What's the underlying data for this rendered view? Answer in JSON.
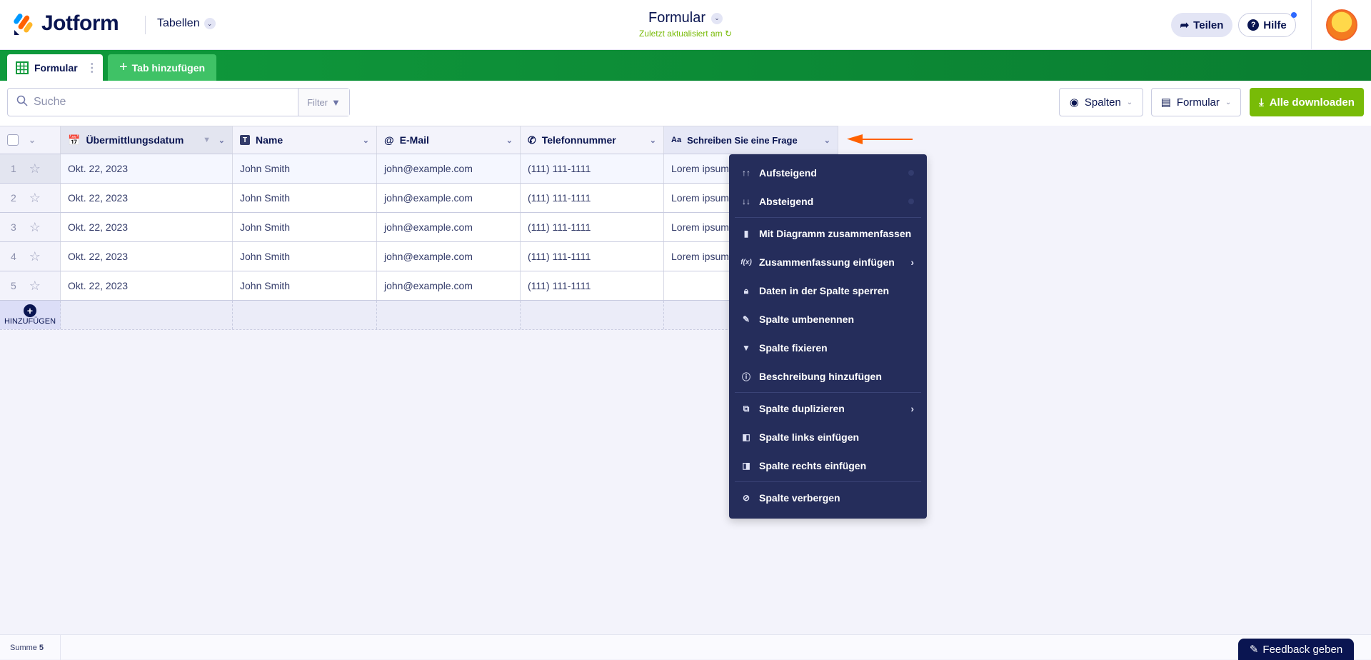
{
  "header": {
    "logo": "Jotform",
    "tables_menu": "Tabellen",
    "title": "Formular",
    "subtitle": "Zuletzt aktualisiert am",
    "share": "Teilen",
    "help": "Hilfe"
  },
  "tabs": {
    "active": "Formular",
    "add": "Tab hinzufügen"
  },
  "toolbar": {
    "search_placeholder": "Suche",
    "filter": "Filter",
    "columns": "Spalten",
    "form": "Formular",
    "download": "Alle downloaden"
  },
  "table": {
    "columns": [
      "Übermittlungsdatum",
      "Name",
      "E-Mail",
      "Telefonnummer",
      "Schreiben Sie eine Frage"
    ],
    "rows": [
      {
        "n": "1",
        "date": "Okt. 22, 2023",
        "name": "John Smith",
        "email": "john@example.com",
        "phone": "(111) 111-1111",
        "q": "Lorem ipsum"
      },
      {
        "n": "2",
        "date": "Okt. 22, 2023",
        "name": "John Smith",
        "email": "john@example.com",
        "phone": "(111) 111-1111",
        "q": "Lorem ipsum"
      },
      {
        "n": "3",
        "date": "Okt. 22, 2023",
        "name": "John Smith",
        "email": "john@example.com",
        "phone": "(111) 111-1111",
        "q": "Lorem ipsum"
      },
      {
        "n": "4",
        "date": "Okt. 22, 2023",
        "name": "John Smith",
        "email": "john@example.com",
        "phone": "(111) 111-1111",
        "q": "Lorem ipsum"
      },
      {
        "n": "5",
        "date": "Okt. 22, 2023",
        "name": "John Smith",
        "email": "john@example.com",
        "phone": "(111) 111-1111",
        "q": ""
      }
    ],
    "add_row": "HINZUFÜGEN"
  },
  "menu": {
    "items": [
      "Aufsteigend",
      "Absteigend",
      "Mit Diagramm zusammenfassen",
      "Zusammenfassung einfügen",
      "Daten in der Spalte sperren",
      "Spalte umbenennen",
      "Spalte fixieren",
      "Beschreibung hinzufügen",
      "Spalte duplizieren",
      "Spalte links einfügen",
      "Spalte rechts einfügen",
      "Spalte verbergen"
    ]
  },
  "footer": {
    "sum_label": "Summe",
    "sum_value": "5",
    "feedback": "Feedback geben"
  },
  "colors": {
    "green": "#0f9a3c",
    "lime": "#78bb07",
    "navy": "#0a1551",
    "menu": "#252d5b",
    "arrow": "#ff6100"
  }
}
